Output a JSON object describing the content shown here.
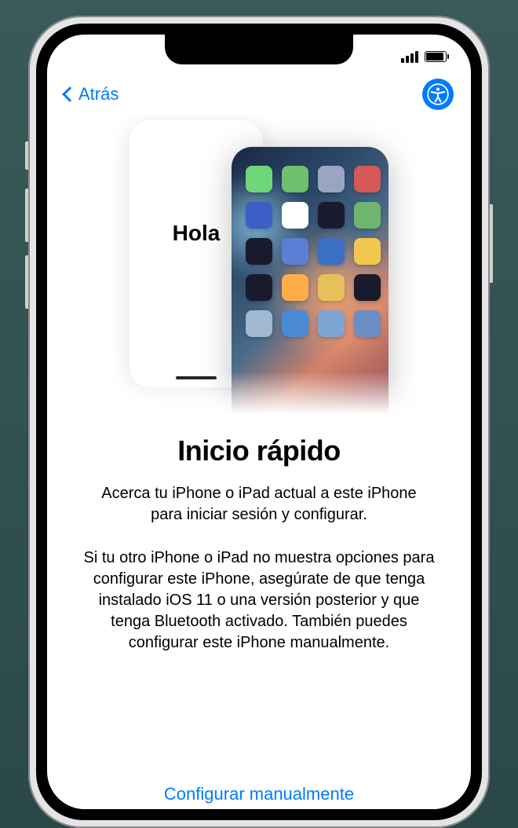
{
  "nav": {
    "back_label": "Atrás"
  },
  "illustration": {
    "greeting": "Hola",
    "app_colors": [
      "#6fd67a",
      "#6fbf6f",
      "#9aa5c4",
      "#d45a5a",
      "#3b5fc4",
      "#ffffff",
      "#1a1a2e",
      "#6fb56f",
      "#1a1a2e",
      "#5a7fd4",
      "#3a6fc4",
      "#f0c850",
      "#1a1a2e",
      "#ffad4a",
      "#e8c05a",
      "#1a1a2e",
      "#a0b8d0",
      "#4a8ad4",
      "#7fa5d4",
      "#6a8fc4"
    ]
  },
  "content": {
    "title": "Inicio rápido",
    "description1": "Acerca tu iPhone o iPad actual a este iPhone para iniciar sesión y configurar.",
    "description2": "Si tu otro iPhone o iPad no muestra opciones para configurar este iPhone, asegúrate de que tenga instalado iOS 11 o una versión posterior y que tenga Bluetooth activado. También puedes configurar este iPhone manualmente."
  },
  "actions": {
    "manual_label": "Configurar manualmente"
  }
}
